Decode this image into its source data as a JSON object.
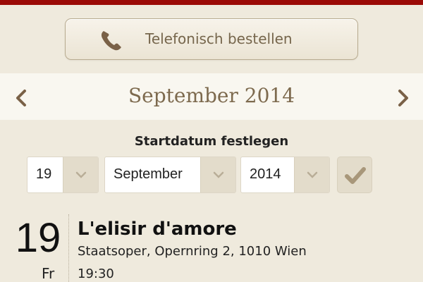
{
  "colors": {
    "top_bar": "#9b0a06",
    "accent_brown": "#7d6a4e",
    "background": "#efeadd"
  },
  "phone_order": {
    "label": "Telefonisch bestellen",
    "icon": "phone-icon"
  },
  "month_nav": {
    "title": "September 2014",
    "prev_icon": "chevron-left-icon",
    "next_icon": "chevron-right-icon"
  },
  "start_date": {
    "label": "Startdatum festlegen",
    "day": "19",
    "month": "September",
    "year": "2014",
    "confirm_icon": "checkmark-icon"
  },
  "event": {
    "day": "19",
    "weekday": "Fr",
    "title": "L'elisir d'amore",
    "venue": "Staatsoper, Opernring 2, 1010 Wien",
    "time": "19:30"
  }
}
